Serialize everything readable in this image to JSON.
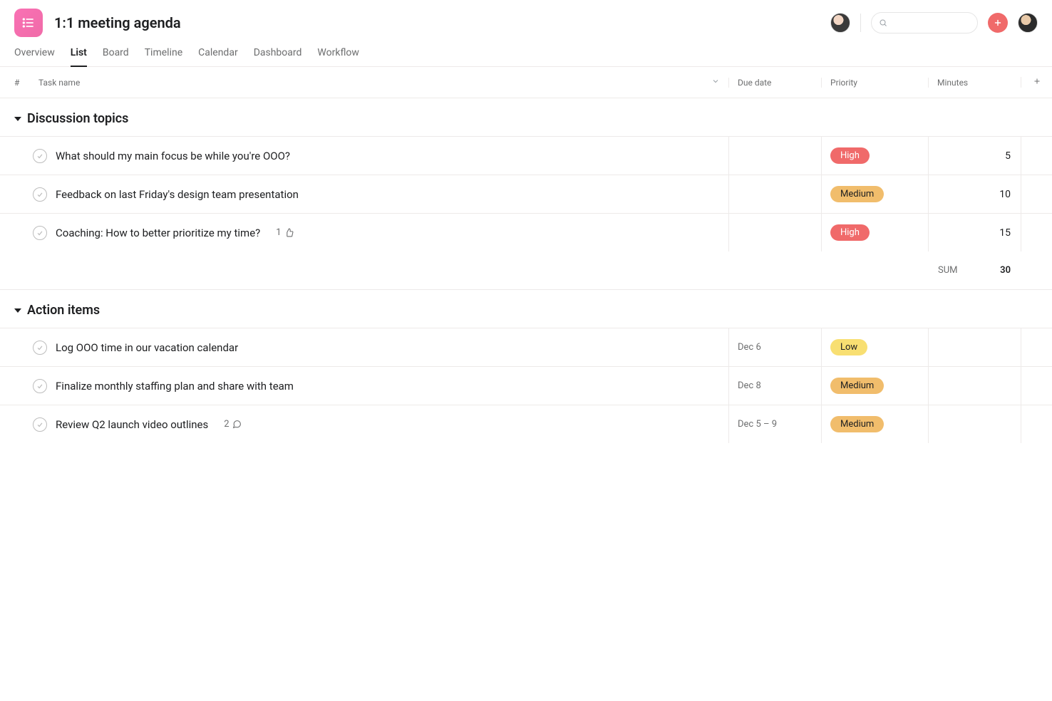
{
  "project": {
    "title": "1:1 meeting agenda"
  },
  "tabs": [
    {
      "label": "Overview"
    },
    {
      "label": "List",
      "active": true
    },
    {
      "label": "Board"
    },
    {
      "label": "Timeline"
    },
    {
      "label": "Calendar"
    },
    {
      "label": "Dashboard"
    },
    {
      "label": "Workflow"
    }
  ],
  "columns": {
    "num": "#",
    "taskname": "Task name",
    "duedate": "Due date",
    "priority": "Priority",
    "minutes": "Minutes"
  },
  "search": {
    "placeholder": ""
  },
  "priority_colors": {
    "High": "#f06a6a",
    "Medium": "#f1bd6c",
    "Low": "#f8df72"
  },
  "sections": [
    {
      "title": "Discussion topics",
      "tasks": [
        {
          "name": "What should my main focus be while you're OOO?",
          "due": "",
          "priority": "High",
          "minutes": "5"
        },
        {
          "name": "Feedback on last Friday's design team presentation",
          "due": "",
          "priority": "Medium",
          "minutes": "10"
        },
        {
          "name": "Coaching: How to better prioritize my time?",
          "due": "",
          "priority": "High",
          "minutes": "15",
          "likes": "1"
        }
      ],
      "sum_label": "SUM",
      "sum_value": "30"
    },
    {
      "title": "Action items",
      "tasks": [
        {
          "name": "Log OOO time in our vacation calendar",
          "due": "Dec 6",
          "priority": "Low",
          "minutes": ""
        },
        {
          "name": "Finalize monthly staffing plan and share with team",
          "due": "Dec 8",
          "priority": "Medium",
          "minutes": ""
        },
        {
          "name": "Review Q2 launch video outlines",
          "due": "Dec 5 – 9",
          "priority": "Medium",
          "minutes": "",
          "comments": "2"
        }
      ]
    }
  ]
}
